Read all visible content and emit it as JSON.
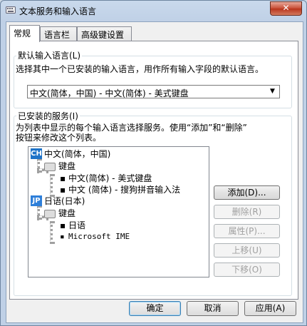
{
  "window": {
    "title": "文本服务和输入语言",
    "close_label": "✕"
  },
  "tabs": [
    {
      "label": "常规",
      "active": true
    },
    {
      "label": "语言栏",
      "active": false
    },
    {
      "label": "高级键设置",
      "active": false
    }
  ],
  "default_language": {
    "group_label": "默认输入语言(L)",
    "description": "选择其中一个已安装的输入语言，用作所有输入字段的默认语言。",
    "selected": "中文(简体，中国) - 中文(简体) - 美式键盘"
  },
  "installed_services": {
    "group_label": "已安装的服务(I)",
    "description_line1": "为列表中显示的每个输入语言选择服务。使用“添加”和“删除”",
    "description_line2": "按钮来修改这个列表。",
    "tree": {
      "lang1": {
        "code": "CH",
        "name": "中文(简体，中国)",
        "category": "键盘",
        "items": [
          "中文(简体) - 美式键盘",
          "中文 (简体) - 搜狗拼音输入法"
        ]
      },
      "lang2": {
        "code": "JP",
        "name": "日语(日本)",
        "category": "键盘",
        "items": [
          "日语",
          "Microsoft IME"
        ]
      }
    }
  },
  "side_buttons": {
    "add": "添加(D)...",
    "remove": "删除(R)",
    "properties": "属性(P)...",
    "move_up": "上移(U)",
    "move_down": "下移(O)"
  },
  "dialog_buttons": {
    "ok": "确定",
    "cancel": "取消",
    "apply": "应用(A)"
  },
  "colors": {
    "ch_icon": "#1e73c8",
    "jp_icon": "#2e7fd9"
  }
}
